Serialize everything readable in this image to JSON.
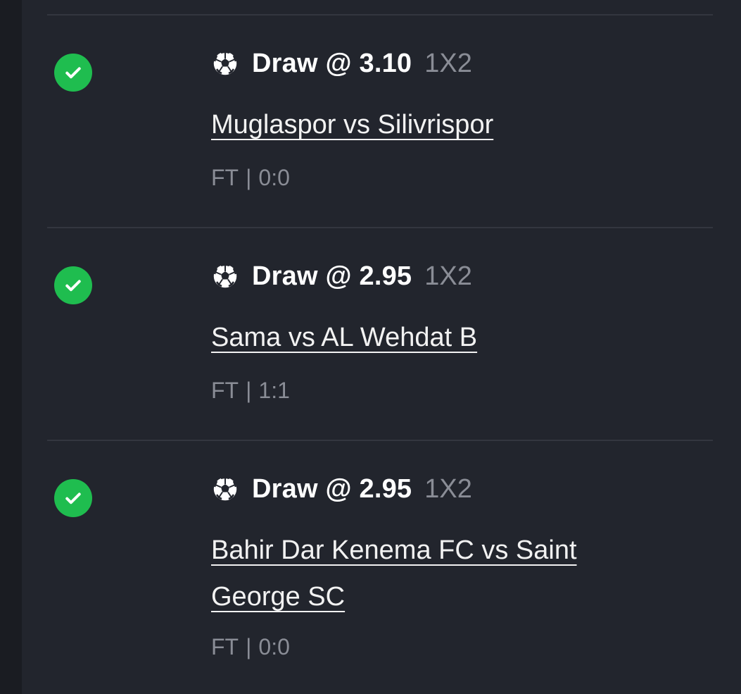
{
  "bets": [
    {
      "status": "won",
      "sport_icon": "soccer-ball-icon",
      "pick": "Draw @ 3.10",
      "market": "1X2",
      "match": "Muglaspor vs Silivrispor",
      "period": "FT",
      "separator": "|",
      "score": "0:0"
    },
    {
      "status": "won",
      "sport_icon": "soccer-ball-icon",
      "pick": "Draw @ 2.95",
      "market": "1X2",
      "match": "Sama vs AL Wehdat B",
      "period": "FT",
      "separator": "|",
      "score": "1:1"
    },
    {
      "status": "won",
      "sport_icon": "soccer-ball-icon",
      "pick": "Draw @ 2.95",
      "market": "1X2",
      "match": "Bahir Dar Kenema FC vs Saint George SC",
      "period": "FT",
      "separator": "|",
      "score": "0:0"
    }
  ],
  "colors": {
    "background": "#1a1c22",
    "panel": "#22252d",
    "divider": "#33363f",
    "success": "#1fbd4f",
    "text_primary": "#ffffff",
    "text_muted": "#8a8d96"
  }
}
